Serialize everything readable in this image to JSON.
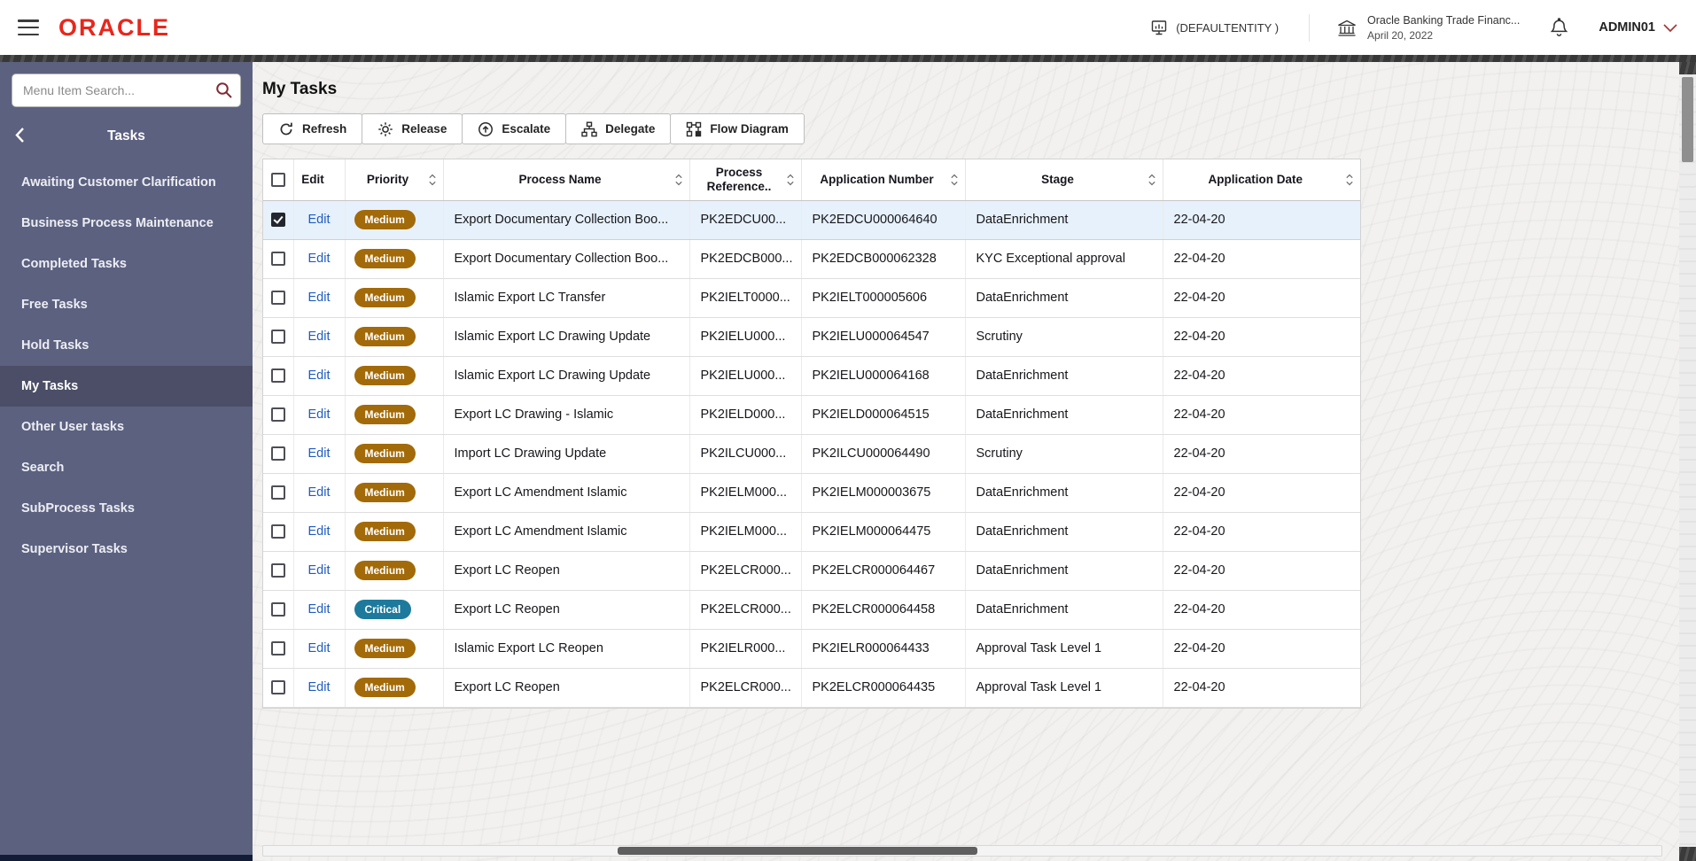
{
  "header": {
    "menu_icon": "hamburger-icon",
    "logo_text": "ORACLE",
    "entity_icon": "entity-building-icon",
    "entity_label": "(DEFAULTENTITY )",
    "app_icon": "bank-icon",
    "app_name": "Oracle Banking Trade Financ...",
    "app_date": "April 20, 2022",
    "notifications_icon": "bell-icon",
    "user_name": "ADMIN01",
    "user_menu_icon": "chevron-down-icon"
  },
  "sidebar": {
    "search_placeholder": "Menu Item Search...",
    "search_icon": "search-icon",
    "back_icon": "chevron-left-icon",
    "section_title": "Tasks",
    "items": [
      {
        "label": "Awaiting Customer Clarification",
        "selected": false
      },
      {
        "label": "Business Process Maintenance",
        "selected": false
      },
      {
        "label": "Completed Tasks",
        "selected": false
      },
      {
        "label": "Free Tasks",
        "selected": false
      },
      {
        "label": "Hold Tasks",
        "selected": false
      },
      {
        "label": "My Tasks",
        "selected": true
      },
      {
        "label": "Other User tasks",
        "selected": false
      },
      {
        "label": "Search",
        "selected": false
      },
      {
        "label": "SubProcess Tasks",
        "selected": false
      },
      {
        "label": "Supervisor Tasks",
        "selected": false
      }
    ]
  },
  "main": {
    "title": "My Tasks",
    "toolbar": [
      {
        "label": "Refresh",
        "icon": "refresh-icon"
      },
      {
        "label": "Release",
        "icon": "release-icon"
      },
      {
        "label": "Escalate",
        "icon": "escalate-icon"
      },
      {
        "label": "Delegate",
        "icon": "delegate-icon"
      },
      {
        "label": "Flow Diagram",
        "icon": "flow-diagram-icon"
      }
    ],
    "table": {
      "edit_label": "Edit",
      "sort_icon": "sort-icon",
      "columns": [
        "Edit",
        "Priority",
        "Process Name",
        "Process Reference..",
        "Application Number",
        "Stage",
        "Application Date"
      ],
      "rows": [
        {
          "checked": true,
          "selected": true,
          "priority": "Medium",
          "process_name": "Export Documentary Collection Boo...",
          "process_ref": "PK2EDCU00...",
          "app_number": "PK2EDCU000064640",
          "stage": "DataEnrichment",
          "app_date": "22-04-20"
        },
        {
          "checked": false,
          "selected": false,
          "priority": "Medium",
          "process_name": "Export Documentary Collection Boo...",
          "process_ref": "PK2EDCB000...",
          "app_number": "PK2EDCB000062328",
          "stage": "KYC Exceptional approval",
          "app_date": "22-04-20"
        },
        {
          "checked": false,
          "selected": false,
          "priority": "Medium",
          "process_name": "Islamic Export LC Transfer",
          "process_ref": "PK2IELT0000...",
          "app_number": "PK2IELT000005606",
          "stage": "DataEnrichment",
          "app_date": "22-04-20"
        },
        {
          "checked": false,
          "selected": false,
          "priority": "Medium",
          "process_name": "Islamic Export LC Drawing Update",
          "process_ref": "PK2IELU000...",
          "app_number": "PK2IELU000064547",
          "stage": "Scrutiny",
          "app_date": "22-04-20"
        },
        {
          "checked": false,
          "selected": false,
          "priority": "Medium",
          "process_name": "Islamic Export LC Drawing Update",
          "process_ref": "PK2IELU000...",
          "app_number": "PK2IELU000064168",
          "stage": "DataEnrichment",
          "app_date": "22-04-20"
        },
        {
          "checked": false,
          "selected": false,
          "priority": "Medium",
          "process_name": "Export LC Drawing - Islamic",
          "process_ref": "PK2IELD000...",
          "app_number": "PK2IELD000064515",
          "stage": "DataEnrichment",
          "app_date": "22-04-20"
        },
        {
          "checked": false,
          "selected": false,
          "priority": "Medium",
          "process_name": "Import LC Drawing Update",
          "process_ref": "PK2ILCU000...",
          "app_number": "PK2ILCU000064490",
          "stage": "Scrutiny",
          "app_date": "22-04-20"
        },
        {
          "checked": false,
          "selected": false,
          "priority": "Medium",
          "process_name": "Export LC Amendment Islamic",
          "process_ref": "PK2IELM000...",
          "app_number": "PK2IELM000003675",
          "stage": "DataEnrichment",
          "app_date": "22-04-20"
        },
        {
          "checked": false,
          "selected": false,
          "priority": "Medium",
          "process_name": "Export LC Amendment Islamic",
          "process_ref": "PK2IELM000...",
          "app_number": "PK2IELM000064475",
          "stage": "DataEnrichment",
          "app_date": "22-04-20"
        },
        {
          "checked": false,
          "selected": false,
          "priority": "Medium",
          "process_name": "Export LC Reopen",
          "process_ref": "PK2ELCR000...",
          "app_number": "PK2ELCR000064467",
          "stage": "DataEnrichment",
          "app_date": "22-04-20"
        },
        {
          "checked": false,
          "selected": false,
          "priority": "Critical",
          "process_name": "Export LC Reopen",
          "process_ref": "PK2ELCR000...",
          "app_number": "PK2ELCR000064458",
          "stage": "DataEnrichment",
          "app_date": "22-04-20"
        },
        {
          "checked": false,
          "selected": false,
          "priority": "Medium",
          "process_name": "Islamic Export LC Reopen",
          "process_ref": "PK2IELR000...",
          "app_number": "PK2IELR000064433",
          "stage": "Approval Task Level 1",
          "app_date": "22-04-20"
        },
        {
          "checked": false,
          "selected": false,
          "priority": "Medium",
          "process_name": "Export LC Reopen",
          "process_ref": "PK2ELCR000...",
          "app_number": "PK2ELCR000064435",
          "stage": "Approval Task Level 1",
          "app_date": "22-04-20"
        }
      ]
    }
  },
  "colors": {
    "oracle_red": "#e8271c",
    "sidebar_bg": "#5d6180",
    "sidebar_selected": "#4b4e66",
    "medium_badge": "#a26a08",
    "critical_badge": "#1d7a9c",
    "link_blue": "#1f5cbe",
    "selected_row_bg": "#e7f1fb"
  }
}
